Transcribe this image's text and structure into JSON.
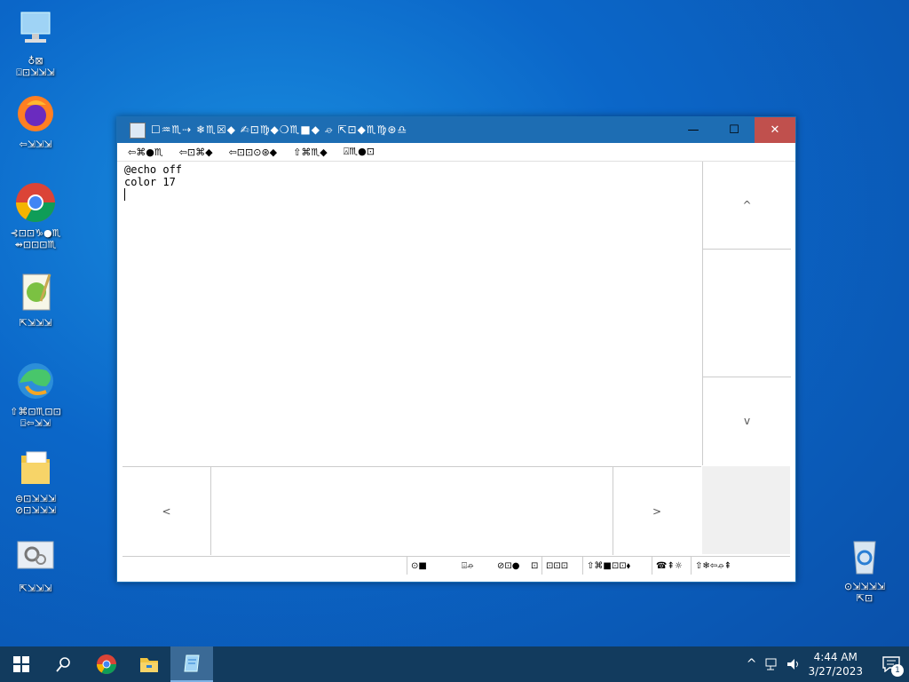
{
  "desktop": {
    "icons": [
      {
        "label": "♁⊠\n⌼⊡⇲⇲⇲",
        "icon": "computer-icon"
      },
      {
        "label": "⇦⇲⇲⇲",
        "icon": "firefox-icon"
      },
      {
        "label": "⊰⊡⊡♑●♏\n⇴⊡⊡⊡♏",
        "icon": "chrome-icon"
      },
      {
        "label": "⇱⇲⇲⇲",
        "icon": "notepadpp-icon"
      },
      {
        "label": "⇧⌘⊡♏⊡⊡\n⌼⇦⇲⇲",
        "icon": "edge-icon"
      },
      {
        "label": "⊜⊡⇲⇲⇲\n⊘⊡⇲⇲⇲",
        "icon": "folder-icon"
      },
      {
        "label": "⇱⇲⇲⇲",
        "icon": "settings-icon"
      },
      {
        "label": "⊙⇲⇲⇲⇲\n⇱⊡",
        "icon": "recycle-bin-icon"
      }
    ]
  },
  "window": {
    "title": "☐♒♏⇢ ❄♏☒◆ ✍⊡♍◆❍♏■◆ ⌮ ⇱⊡◆♏♍⊛♎",
    "minimize": "—",
    "maximize": "☐",
    "close": "✕",
    "menu": [
      "⇦⌘●♏",
      "⇦⊡⌘◆",
      "⇦⊡⊡⊙⊛◆",
      "⇧⌘♏◆",
      "⍓♏●⊡"
    ],
    "content_lines": [
      "@echo off",
      "color 17"
    ],
    "vscroll": {
      "up": "^",
      "down": "v"
    },
    "hscroll": {
      "left": "<",
      "right": ">"
    },
    "status": [
      "⊙■",
      "⌹⌮",
      "⊘⊡●",
      "⊡",
      "⊡⊡⊡",
      "⇧⌘■⊡⊡⬧",
      "☎⇞☼",
      "⇧❄⇦⌮⇞"
    ]
  },
  "taskbar": {
    "time": "4:44 AM",
    "date": "3/27/2023",
    "notifications": "1"
  }
}
